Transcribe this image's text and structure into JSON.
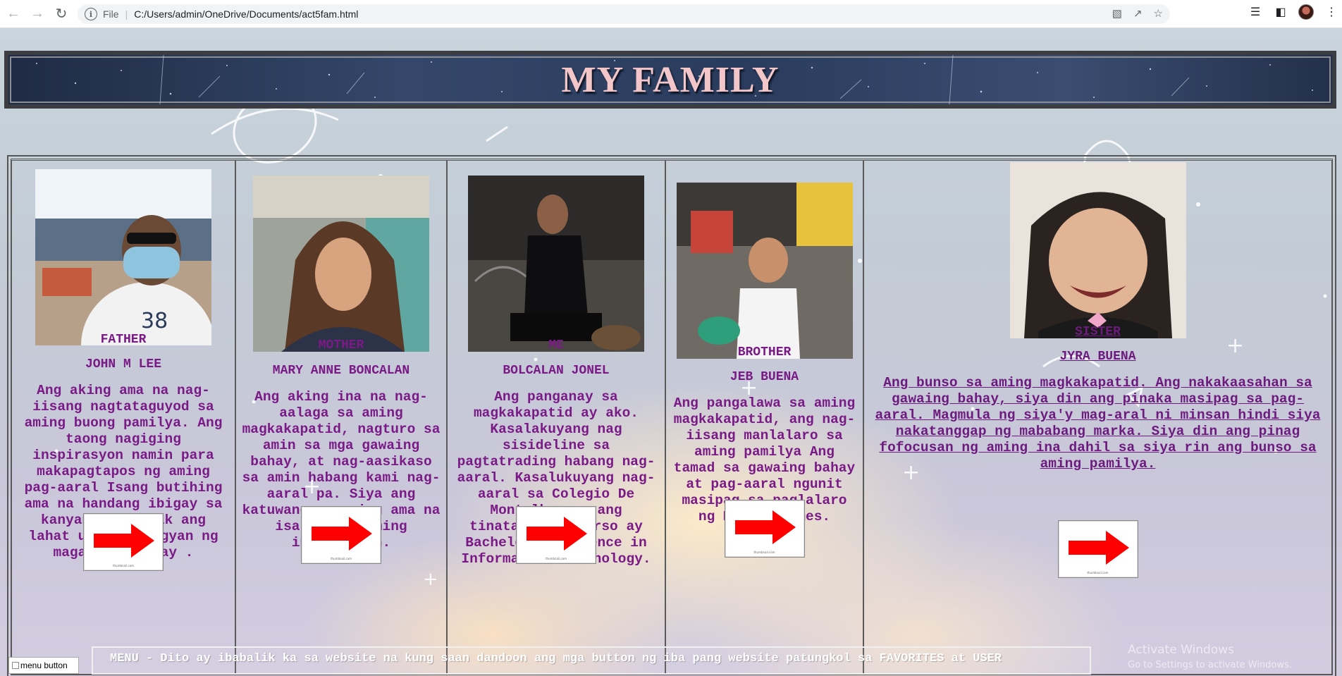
{
  "browser": {
    "scheme_label": "File",
    "address": "C:/Users/admin/OneDrive/Documents/act5fam.html",
    "icons": [
      "back-arrow-icon",
      "forward-arrow-icon",
      "reload-icon",
      "info-icon",
      "translate-icon",
      "share-icon",
      "bookmark-star-icon",
      "reading-list-icon",
      "side-panel-icon",
      "profile-avatar",
      "kebab-menu-icon"
    ]
  },
  "header": {
    "title": "MY FAMILY"
  },
  "members": [
    {
      "role": "FATHER",
      "name": "JOHN M LEE",
      "desc": "Ang aking ama na nag-iisang nagtataguyod sa aming buong pamilya. Ang taong nagiging inspirasyon namin para makapagtapos ng aming pag-aaral Isang butihing ama na handang ibigay sa kanyang mga anak ang lahat upang mabigyan ng magandang buhay .",
      "button_caption": "thumbnail.com"
    },
    {
      "role": "MOTHER",
      "name": "MARY ANNE BONCALAN",
      "desc": "Ang aking ina na nag-aalaga sa aming magkakapatid, nagturo sa amin sa mga gawaing bahay, at nag-aasikaso sa amin habang kami nag-aaral pa. Siya ang katuwang ng aming ama na isa din sa aming inspirasyon.",
      "button_caption": "thumbnail.com"
    },
    {
      "role": "ME",
      "name": "BOLCALAN JONEL",
      "desc": "Ang panganay sa magkakapatid ay ako. Kasalakuyang nag sisideline sa pagtatrading habang nag-aaral. Kasalukuyang nag-aaral sa Colegio De Montalban na ang tinatahak na kurso ay Bachelor of Science in Information Technology.",
      "button_caption": "thumbnail.com"
    },
    {
      "role": "BROTHER",
      "name": "JEB BUENA",
      "desc": "Ang pangalawa sa aming magkakapatid, ang nag-iisang manlalaro sa aming pamilya Ang tamad sa gawaing bahay at pag-aaral ngunit masipag sa paglalaro ng Mobile games.",
      "button_caption": "thumbnail.com"
    },
    {
      "role": "SISTER",
      "name": "JYRA BUENA",
      "desc": "Ang bunso sa aming magkakapatid. Ang nakakaasahan sa gawaing bahay, siya din ang pinaka masipag sa pag-aaral. Magmula ng siya'y mag-aral ni minsan hindi siya nakatanggap ng mababang marka. Siya din ang pinag fofocusan ng aming ina dahil sa siya rin ang bunso sa aming pamilya.",
      "button_caption": "thumbnail.com"
    }
  ],
  "menu": {
    "text": "MENU - Dito ay ibabalik ka sa website na kung saan dandoon ang mga button ng iba pang website patungkol sa FAVORITES at USER",
    "button_alt": "menu button"
  },
  "watermark": {
    "line1": "Activate Windows",
    "line2": "Go to Settings to activate Windows."
  },
  "colors": {
    "text_purple": "#7a1a86",
    "title_pink": "#f3c7c9",
    "arrow_red": "#ff0000"
  }
}
